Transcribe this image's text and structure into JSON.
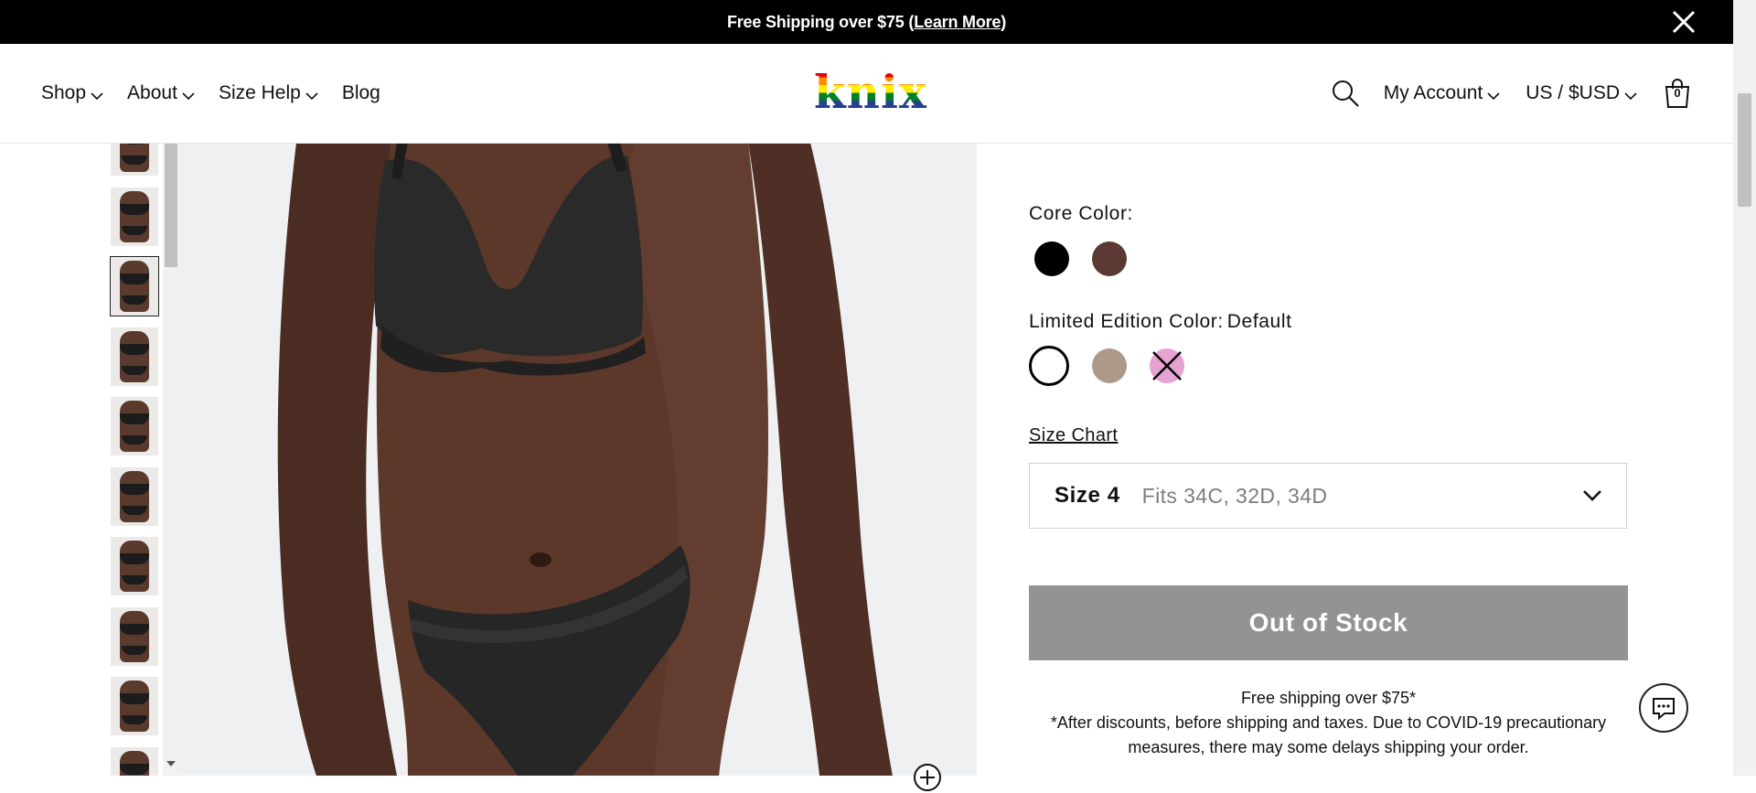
{
  "announcement": {
    "text": "Free Shipping over $75 (",
    "link": "Learn More",
    "suffix": ")"
  },
  "nav": {
    "left": [
      {
        "label": "Shop"
      },
      {
        "label": "About"
      },
      {
        "label": "Size Help"
      },
      {
        "label": "Blog"
      }
    ],
    "logo": "knix",
    "account": "My Account",
    "currency": "US / $USD",
    "bag_count": "0"
  },
  "gallery": {
    "thumbnail_count": 10,
    "selected_index": 2
  },
  "product": {
    "core_color_label": "Core Color:",
    "core_colors": [
      "#000000",
      "#5a3a33"
    ],
    "limited_color_label": "Limited Edition Color:",
    "limited_color_value": "Default",
    "limited_colors": [
      "#ffffff",
      "#ad998a",
      "#e6a3d1"
    ],
    "size_chart": "Size Chart",
    "size_name": "Size 4",
    "size_fit": "Fits 34C, 32D, 34D",
    "button": "Out of Stock",
    "shipping_line1": "Free shipping over $75*",
    "shipping_line2": "*After discounts, before shipping and taxes. Due to COVID-19 precautionary measures, there may some delays shipping your order."
  }
}
